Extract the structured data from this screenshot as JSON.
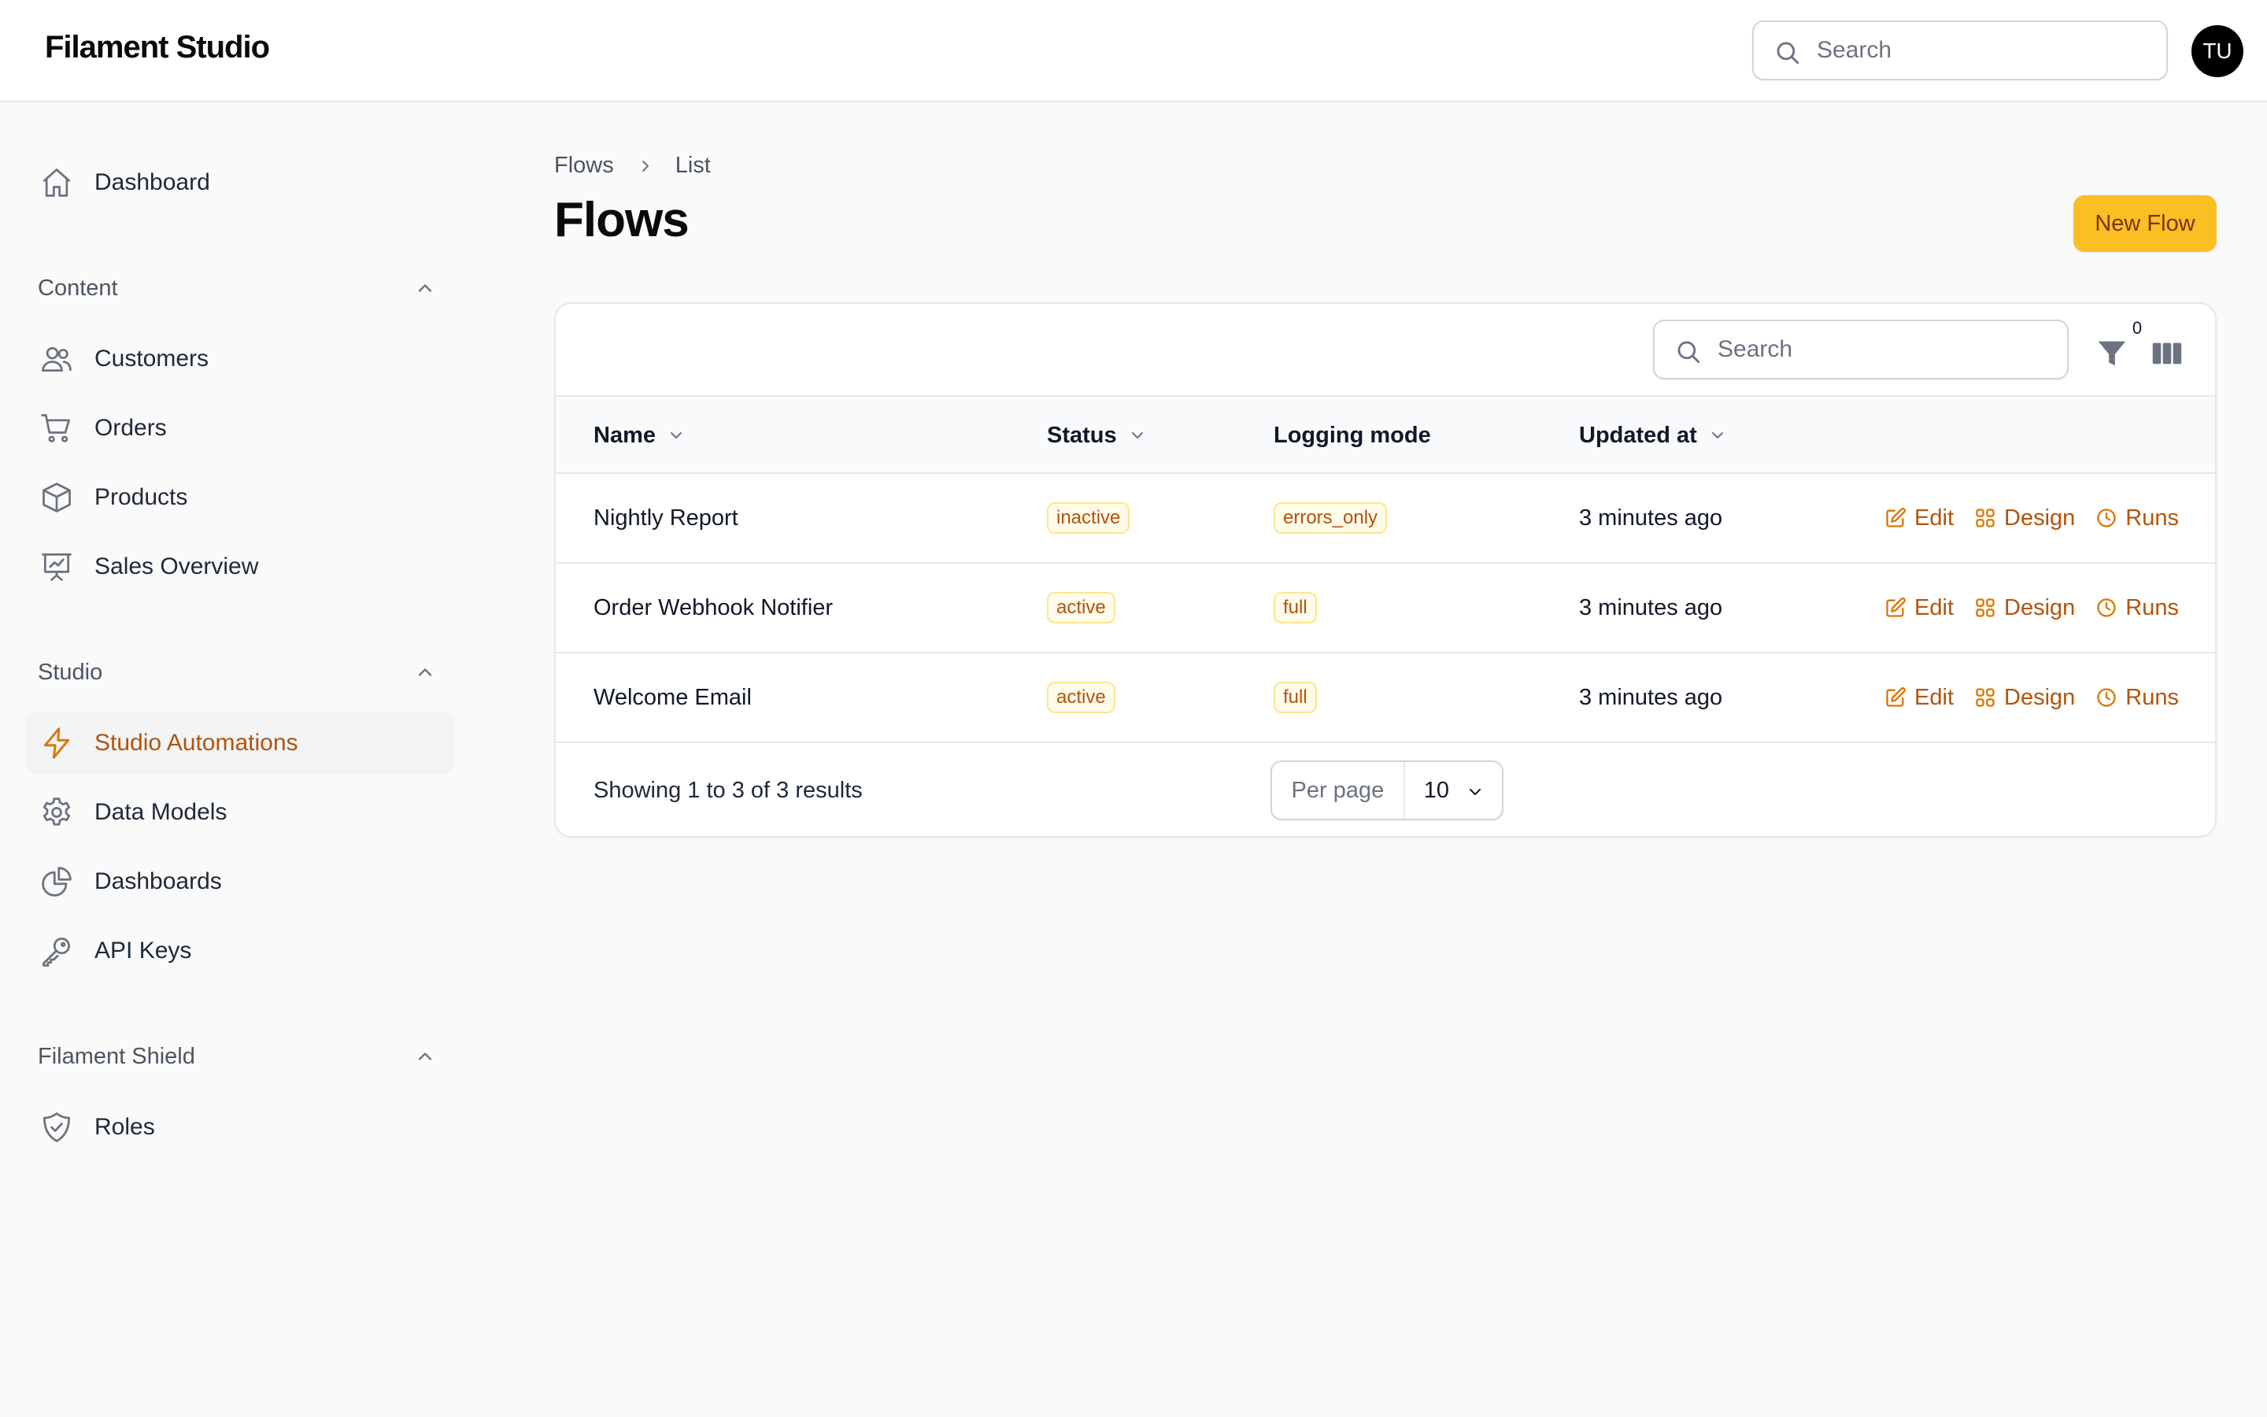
{
  "app": {
    "title": "Filament Studio",
    "search_placeholder": "Search",
    "user_initials": "TU"
  },
  "sidebar": {
    "dashboard": {
      "label": "Dashboard",
      "icon": "home-icon"
    },
    "groups": [
      {
        "label": "Content",
        "items": [
          {
            "label": "Customers",
            "icon": "users-icon"
          },
          {
            "label": "Orders",
            "icon": "cart-icon"
          },
          {
            "label": "Products",
            "icon": "cube-icon"
          },
          {
            "label": "Sales Overview",
            "icon": "presentation-chart-icon"
          }
        ]
      },
      {
        "label": "Studio",
        "items": [
          {
            "label": "Studio Automations",
            "icon": "bolt-icon",
            "active": true
          },
          {
            "label": "Data Models",
            "icon": "gear-icon"
          },
          {
            "label": "Dashboards",
            "icon": "pie-chart-icon"
          },
          {
            "label": "API Keys",
            "icon": "key-icon"
          }
        ]
      },
      {
        "label": "Filament Shield",
        "items": [
          {
            "label": "Roles",
            "icon": "shield-check-icon"
          }
        ]
      }
    ]
  },
  "breadcrumb": [
    "Flows",
    "List"
  ],
  "page": {
    "title": "Flows",
    "new_button": "New Flow"
  },
  "table": {
    "search_placeholder": "Search",
    "filter_count": "0",
    "columns": [
      {
        "label": "Name",
        "sortable": true
      },
      {
        "label": "Status",
        "sortable": true
      },
      {
        "label": "Logging mode",
        "sortable": false
      },
      {
        "label": "Updated at",
        "sortable": true
      }
    ],
    "rows": [
      {
        "name": "Nightly Report",
        "status": "inactive",
        "logging_mode": "errors_only",
        "updated_at": "3 minutes ago"
      },
      {
        "name": "Order Webhook Notifier",
        "status": "active",
        "logging_mode": "full",
        "updated_at": "3 minutes ago"
      },
      {
        "name": "Welcome Email",
        "status": "active",
        "logging_mode": "full",
        "updated_at": "3 minutes ago"
      }
    ],
    "row_actions": [
      "Edit",
      "Design",
      "Runs"
    ],
    "footer": {
      "results": "Showing 1 to 3 of 3 results",
      "per_page_label": "Per page",
      "per_page_value": "10"
    }
  },
  "colors": {
    "accent": "#fbbf24",
    "accent_text": "#b45309",
    "background": "#fafafa"
  }
}
